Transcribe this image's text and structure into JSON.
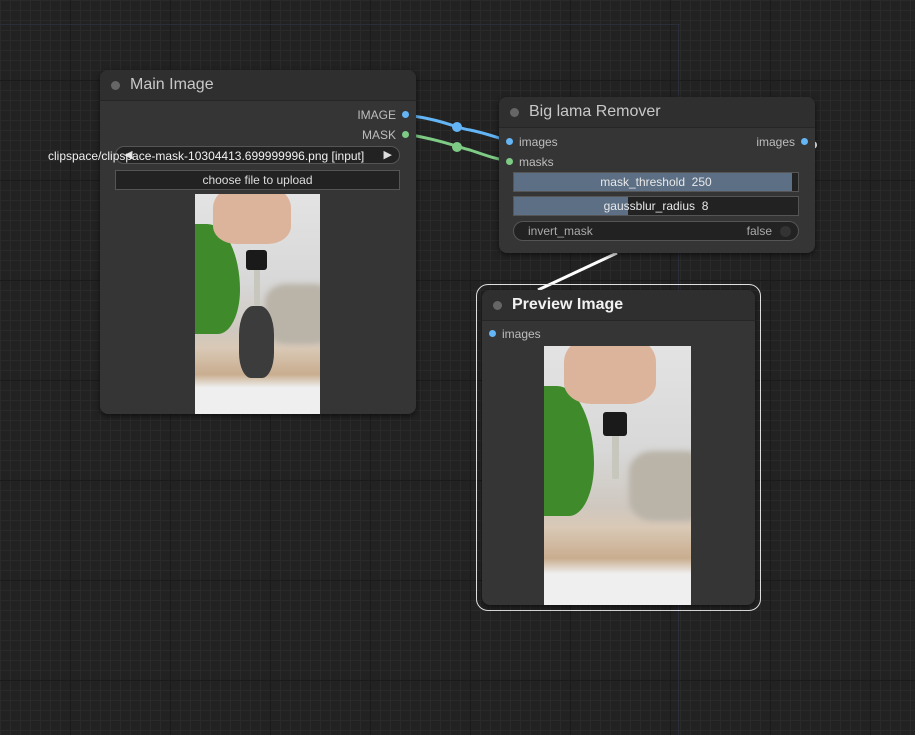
{
  "nodes": {
    "main_image": {
      "title": "Main Image",
      "outputs": [
        {
          "label": "IMAGE",
          "color": "#64b5f6"
        },
        {
          "label": "MASK",
          "color": "#7ecb85"
        }
      ],
      "file_label": "clipspace/clipspace-mask-10304413.699999996.png [input]",
      "file_left_arrow": "◀",
      "file_right_arrow": "▶",
      "upload_label": "choose file to upload"
    },
    "big_lama": {
      "title": "Big lama Remover",
      "inputs": [
        {
          "label": "images",
          "color": "#64b5f6"
        },
        {
          "label": "masks",
          "color": "#7ecb85"
        }
      ],
      "outputs": [
        {
          "label": "images",
          "color": "#64b5f6"
        }
      ],
      "mask_threshold": {
        "label": "mask_threshold",
        "value": "250",
        "fill_fraction": 0.98
      },
      "gaussblur_radius": {
        "label": "gaussblur_radius",
        "value": "8",
        "fill_fraction": 0.4
      },
      "invert_mask": {
        "label": "invert_mask",
        "value": "false"
      }
    },
    "preview": {
      "title": "Preview Image",
      "inputs": [
        {
          "label": "images",
          "color": "#64b5f6"
        }
      ]
    }
  },
  "colors": {
    "image_link": "#64b5f6",
    "mask_link": "#7ecb85",
    "output_link": "#ffffff",
    "background": "#222222",
    "node_body": "#353535"
  }
}
